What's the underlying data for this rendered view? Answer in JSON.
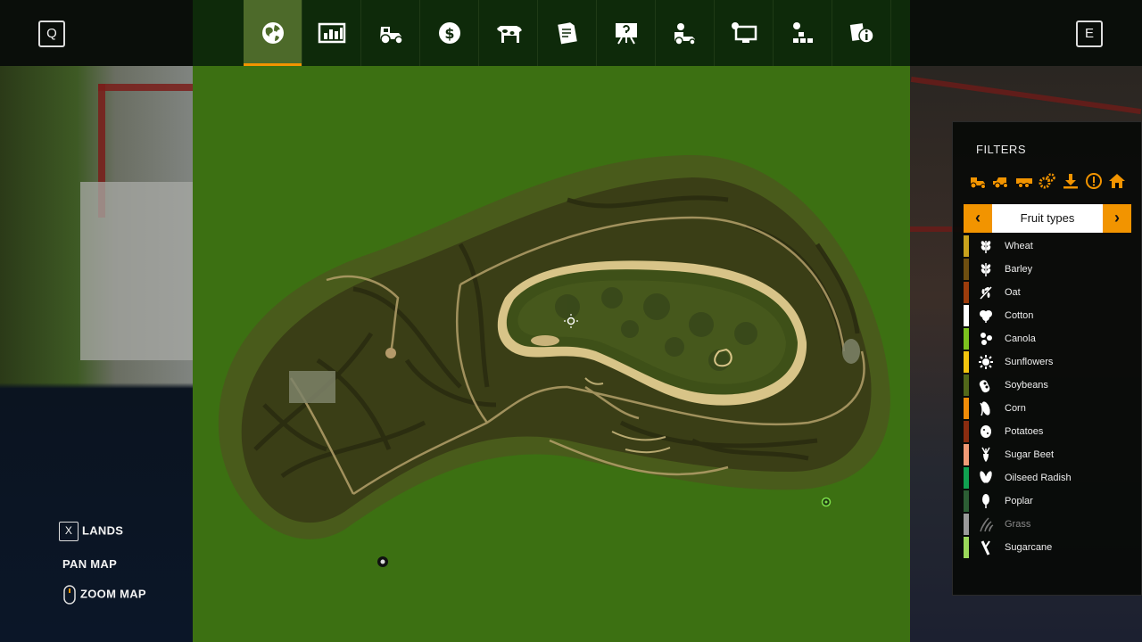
{
  "topbar": {
    "left_key": "Q",
    "right_key": "E",
    "tabs": [
      {
        "icon": "globe-icon",
        "active": true
      },
      {
        "icon": "statistics-icon",
        "active": false
      },
      {
        "icon": "tractor-icon",
        "active": false
      },
      {
        "icon": "finances-icon",
        "active": false
      },
      {
        "icon": "animals-icon",
        "active": false
      },
      {
        "icon": "contracts-icon",
        "active": false
      },
      {
        "icon": "tutorial-icon",
        "active": false
      },
      {
        "icon": "garage-icon",
        "active": false
      },
      {
        "icon": "production-icon",
        "active": false
      },
      {
        "icon": "settings-icon",
        "active": false
      },
      {
        "icon": "help-icon",
        "active": false
      }
    ]
  },
  "filters": {
    "title": "FILTERS",
    "category_icons": [
      "tractor-icon",
      "harvester-icon",
      "trailer-icon",
      "gears-icon",
      "download-icon",
      "warning-icon",
      "farmhouse-icon"
    ],
    "selector": {
      "label": "Fruit types",
      "prev": "‹",
      "next": "›"
    },
    "items": [
      {
        "label": "Wheat",
        "color": "#c9a21c",
        "icon": "wheat-icon"
      },
      {
        "label": "Barley",
        "color": "#6e4e10",
        "icon": "barley-icon"
      },
      {
        "label": "Oat",
        "color": "#9c3c0c",
        "icon": "oat-icon"
      },
      {
        "label": "Cotton",
        "color": "#ffffff",
        "icon": "cotton-icon"
      },
      {
        "label": "Canola",
        "color": "#7cc21e",
        "icon": "canola-icon"
      },
      {
        "label": "Sunflowers",
        "color": "#f2c40e",
        "icon": "sunflower-icon"
      },
      {
        "label": "Soybeans",
        "color": "#52681a",
        "icon": "soybean-icon"
      },
      {
        "label": "Corn",
        "color": "#f08c08",
        "icon": "corn-icon"
      },
      {
        "label": "Potatoes",
        "color": "#8a2c10",
        "icon": "potato-icon"
      },
      {
        "label": "Sugar Beet",
        "color": "#f09a76",
        "icon": "sugarbeet-icon"
      },
      {
        "label": "Oilseed Radish",
        "color": "#10a050",
        "icon": "radish-icon"
      },
      {
        "label": "Poplar",
        "color": "#2c5e34",
        "icon": "poplar-icon"
      },
      {
        "label": "Grass",
        "color": "#9a9a9a",
        "icon": "grass-icon"
      },
      {
        "label": "Sugarcane",
        "color": "#9ad85a",
        "icon": "sugarcane-icon"
      }
    ]
  },
  "controls": {
    "lands_key": "X",
    "lands_label": "LANDS",
    "pan_label": "PAN MAP",
    "zoom_label": "ZOOM MAP"
  },
  "colors": {
    "accent": "#f29400",
    "tab_bg": "#0e2a0a",
    "map_bg": "#3c7012"
  }
}
